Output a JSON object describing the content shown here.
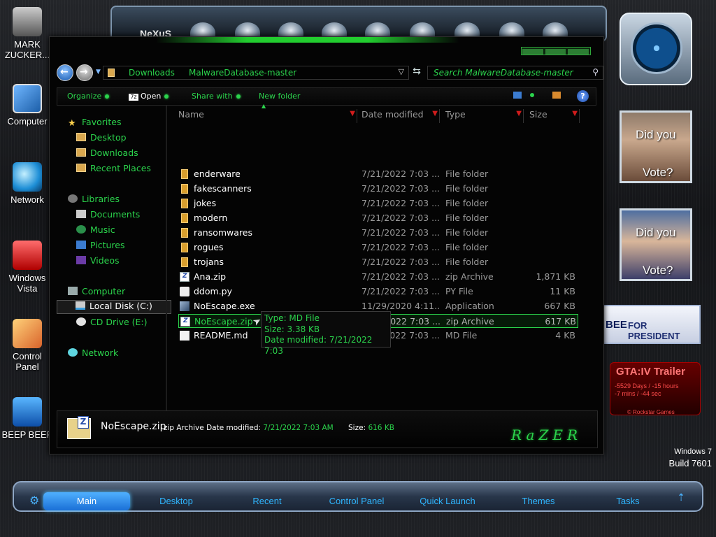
{
  "desktop_icons": [
    {
      "label": "MARK ZUCKER...",
      "icon": "user-icon"
    },
    {
      "label": "Computer",
      "icon": "computer-icon"
    },
    {
      "label": "Network",
      "icon": "network-icon"
    },
    {
      "label": "Windows Vista",
      "icon": "recycle-bin-icon"
    },
    {
      "label": "Control Panel",
      "icon": "control-panel-icon"
    },
    {
      "label": "BEEP BEEP",
      "icon": "beep-icon"
    }
  ],
  "top_dock": {
    "logo": "NeXuS"
  },
  "gadgets": {
    "photo1": {
      "line1": "Did you",
      "line2": "Vote?"
    },
    "photo2": {
      "line1": "Did you",
      "line2": "Vote?"
    },
    "bee": {
      "left": "BEE",
      "right": "FOR PRESIDENT"
    },
    "gta": {
      "title": "GTA:IV Trailer",
      "line1": "-5529 Days / -15 hours",
      "line2": "-7 mins / -44 sec",
      "credit": "© Rockstar Games"
    }
  },
  "os_info": {
    "line1": "Windows 7",
    "line2": "Build 7601"
  },
  "explorer": {
    "address": {
      "crumbs": [
        "Downloads",
        "MalwareDatabase-master"
      ]
    },
    "search": {
      "placeholder": "Search MalwareDatabase-master"
    },
    "commands": {
      "organize": "Organize",
      "open": "Open",
      "open_badge": "7z",
      "share_with": "Share with",
      "new_folder": "New folder",
      "help": "?"
    },
    "navpane": {
      "favorites": "Favorites",
      "desktop": "Desktop",
      "downloads": "Downloads",
      "recent_places": "Recent Places",
      "libraries": "Libraries",
      "documents": "Documents",
      "music": "Music",
      "pictures": "Pictures",
      "videos": "Videos",
      "computer": "Computer",
      "local_disk": "Local Disk (C:)",
      "cd_drive": "CD Drive (E:)",
      "network": "Network"
    },
    "columns": {
      "name": "Name",
      "date": "Date modified",
      "type": "Type",
      "size": "Size"
    },
    "files": [
      {
        "name": "enderware",
        "date": "7/21/2022 7:03 ...",
        "type": "File folder",
        "size": ""
      },
      {
        "name": "fakescanners",
        "date": "7/21/2022 7:03 ...",
        "type": "File folder",
        "size": ""
      },
      {
        "name": "jokes",
        "date": "7/21/2022 7:03 ...",
        "type": "File folder",
        "size": ""
      },
      {
        "name": "modern",
        "date": "7/21/2022 7:03 ...",
        "type": "File folder",
        "size": ""
      },
      {
        "name": "ransomwares",
        "date": "7/21/2022 7:03 ...",
        "type": "File folder",
        "size": ""
      },
      {
        "name": "rogues",
        "date": "7/21/2022 7:03 ...",
        "type": "File folder",
        "size": ""
      },
      {
        "name": "trojans",
        "date": "7/21/2022 7:03 ...",
        "type": "File folder",
        "size": ""
      },
      {
        "name": "Ana.zip",
        "date": "7/21/2022 7:03 ...",
        "type": "zip Archive",
        "size": "1,871 KB"
      },
      {
        "name": "ddom.py",
        "date": "7/21/2022 7:03 ...",
        "type": "PY File",
        "size": "11 KB"
      },
      {
        "name": "NoEscape.exe",
        "date": "11/29/2020 4:11...",
        "type": "Application",
        "size": "667 KB"
      },
      {
        "name": "NoEscape.zip",
        "date": "7/21/2022 7:03 ...",
        "type": "zip Archive",
        "size": "617 KB"
      },
      {
        "name": "README.md",
        "date": "7/21/2022 7:03 ...",
        "type": "MD File",
        "size": "4 KB"
      }
    ],
    "tooltip": {
      "type": "Type: MD File",
      "size": "Size: 3.38 KB",
      "date": "Date modified: 7/21/2022 7:03"
    },
    "details": {
      "filename": "NoEscape.zip",
      "type_label": "zip Archive",
      "date_label": "Date modified:",
      "date_value": "7/21/2022 7:03 AM",
      "size_label": "Size:",
      "size_value": "616 KB",
      "brand": "RaZER"
    }
  },
  "taskbar": {
    "tabs": [
      "Main",
      "Desktop",
      "Recent",
      "Control Panel",
      "Quick Launch",
      "Themes",
      "Tasks"
    ]
  },
  "colors": {
    "accent_green": "#2bd34c",
    "taskbar_blue": "#2fb6ff"
  }
}
